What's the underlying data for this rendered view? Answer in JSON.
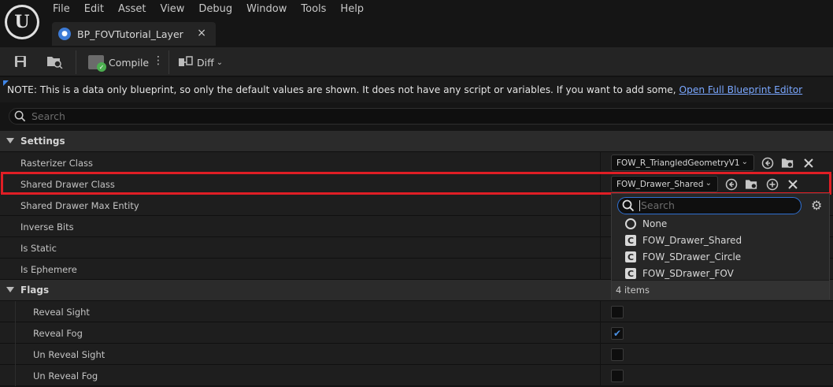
{
  "menu": [
    "File",
    "Edit",
    "Asset",
    "View",
    "Debug",
    "Window",
    "Tools",
    "Help"
  ],
  "tab": {
    "title": "BP_FOVTutorial_Layer",
    "close": "×"
  },
  "toolbar": {
    "compile_label": "Compile",
    "diff_label": "Diff",
    "more": "⋮",
    "chevron": "⌄"
  },
  "note": {
    "text": "NOTE: This is a data only blueprint, so only the default values are shown.  It does not have any script or variables.  If you want to add some, ",
    "link": "Open Full Blueprint Editor"
  },
  "search": {
    "placeholder": "Search"
  },
  "details": {
    "settings": {
      "label": "Settings",
      "rasterizer_class": {
        "label": "Rasterizer Class",
        "value": "FOW_R_TriangledGeometryV1"
      },
      "shared_drawer_class": {
        "label": "Shared Drawer Class",
        "value": "FOW_Drawer_Shared"
      },
      "shared_drawer_max_entity": {
        "label": "Shared Drawer Max Entity"
      },
      "inverse_bits": {
        "label": "Inverse Bits"
      },
      "is_static": {
        "label": "Is Static"
      },
      "is_ephemere": {
        "label": "Is Ephemere"
      }
    },
    "flags": {
      "label": "Flags",
      "items": [
        {
          "label": "Reveal Sight",
          "checked": false
        },
        {
          "label": "Reveal Fog",
          "checked": true
        },
        {
          "label": "Un Reveal Sight",
          "checked": false
        },
        {
          "label": "Un Reveal Fog",
          "checked": false
        }
      ]
    }
  },
  "dropdown": {
    "search_placeholder": "Search",
    "items": [
      "None",
      "FOW_Drawer_Shared",
      "FOW_SDrawer_Circle",
      "FOW_SDrawer_FOV"
    ],
    "count_text": "4 items"
  },
  "colors": {
    "highlight": "#e01e25",
    "accent": "#3f86e8",
    "link": "#7aa7ff",
    "check": "#4a90e2"
  }
}
